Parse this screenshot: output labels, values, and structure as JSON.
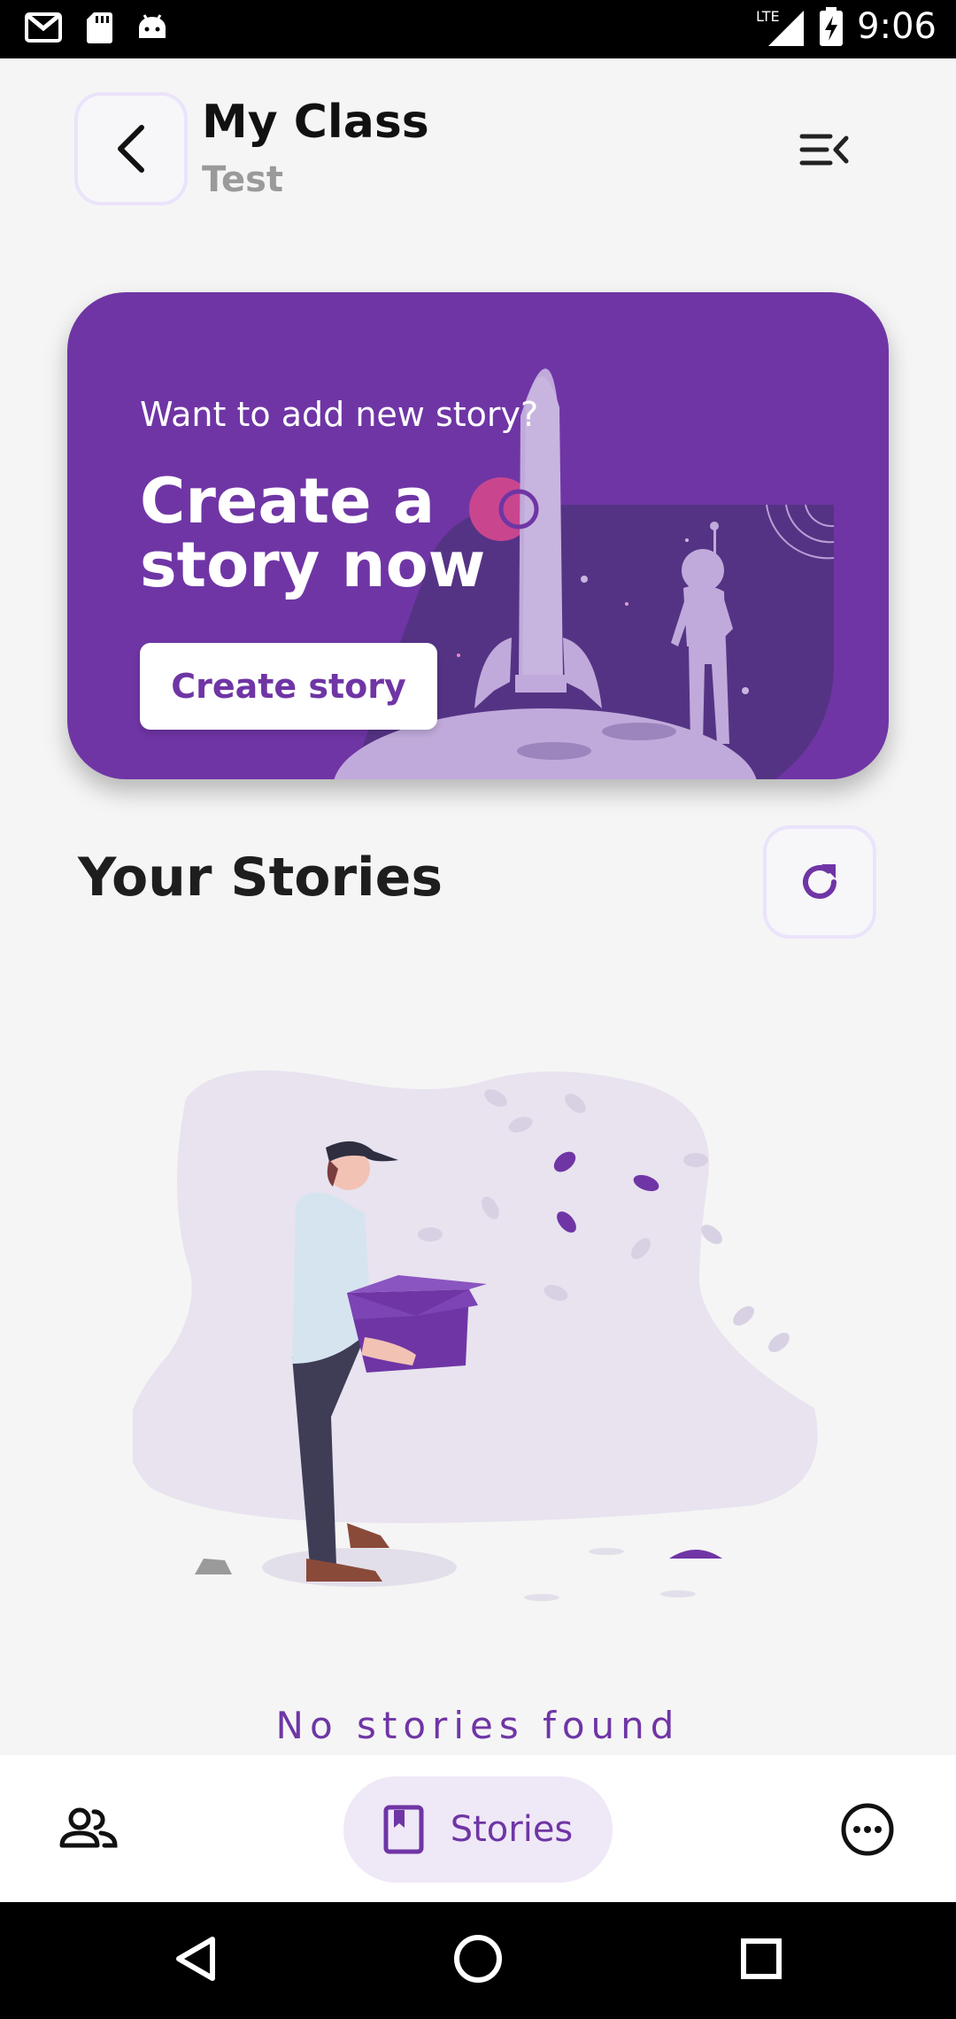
{
  "status_bar": {
    "time": "9:06",
    "network": "LTE",
    "left_icons": [
      "gmail-icon",
      "sd-card-icon",
      "android-icon"
    ],
    "right_icons": [
      "signal-icon",
      "battery-charging-icon"
    ]
  },
  "header": {
    "title": "My Class",
    "subtitle": "Test",
    "back_icon": "chevron-left-icon",
    "menu_icon": "menu-collapse-icon"
  },
  "banner": {
    "question": "Want to add new story?",
    "headline": "Create a story now",
    "button_label": "Create story",
    "background_color": "#6f35a5"
  },
  "stories": {
    "title": "Your Stories",
    "refresh_icon": "refresh-icon",
    "empty_message": "No stories found"
  },
  "bottom_nav": {
    "items": [
      {
        "icon": "people-icon",
        "label": ""
      },
      {
        "icon": "book-icon",
        "label": "Stories",
        "active": true
      },
      {
        "icon": "more-icon",
        "label": ""
      }
    ],
    "accent_color": "#6f35a5",
    "active_bg": "#efe8f7"
  },
  "system_nav": [
    "back-triangle-icon",
    "home-circle-icon",
    "recents-square-icon"
  ]
}
